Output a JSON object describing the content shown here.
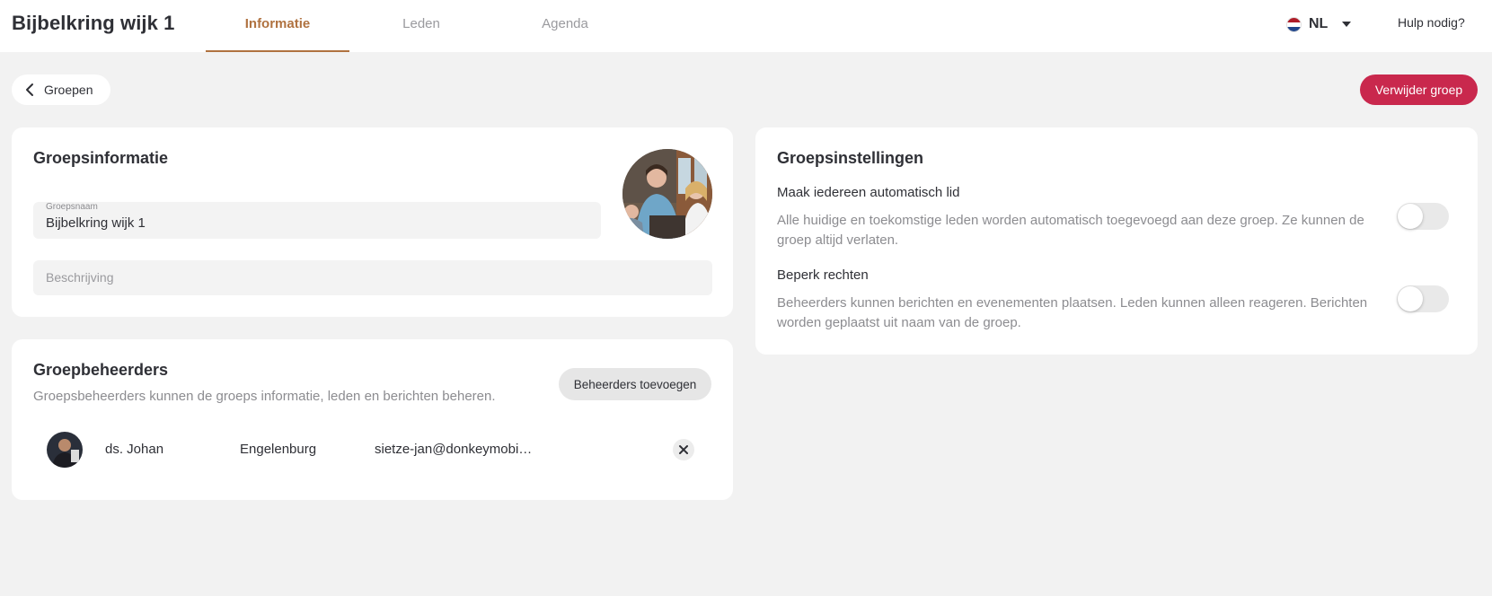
{
  "header": {
    "title": "Bijbelkring wijk 1",
    "tabs": [
      {
        "label": "Informatie",
        "active": true
      },
      {
        "label": "Leden",
        "active": false
      },
      {
        "label": "Agenda",
        "active": false
      }
    ],
    "language": {
      "code": "NL",
      "flag_icon": "netherlands-flag-icon"
    },
    "help_label": "Hulp nodig?"
  },
  "toolbar": {
    "back_label": "Groepen",
    "delete_label": "Verwijder groep"
  },
  "group_info": {
    "title": "Groepsinformatie",
    "name_field": {
      "label": "Groepsnaam",
      "value": "Bijbelkring wijk 1"
    },
    "description_field": {
      "placeholder": "Beschrijving",
      "value": ""
    }
  },
  "admins": {
    "title": "Groepbeheerders",
    "subtitle": "Groepsbeheerders kunnen de groeps informatie, leden en berichten beheren.",
    "add_label": "Beheerders toevoegen",
    "rows": [
      {
        "first_name": "ds. Johan",
        "last_name": "Engelenburg",
        "email": "sietze-jan@donkeymobi…"
      }
    ]
  },
  "settings": {
    "title": "Groepsinstellingen",
    "items": [
      {
        "title": "Maak iedereen automatisch lid",
        "description": "Alle huidige en toekomstige leden worden automatisch toegevoegd aan deze groep. Ze kunnen de groep altijd verlaten.",
        "enabled": false
      },
      {
        "title": "Beperk rechten",
        "description": "Beheerders kunnen berichten en evenementen plaatsen. Leden kunnen alleen reageren. Berichten worden geplaatst uit naam van de groep.",
        "enabled": false
      }
    ]
  },
  "colors": {
    "accent": "#b07240",
    "danger": "#c9284d",
    "background": "#f2f2f2"
  }
}
